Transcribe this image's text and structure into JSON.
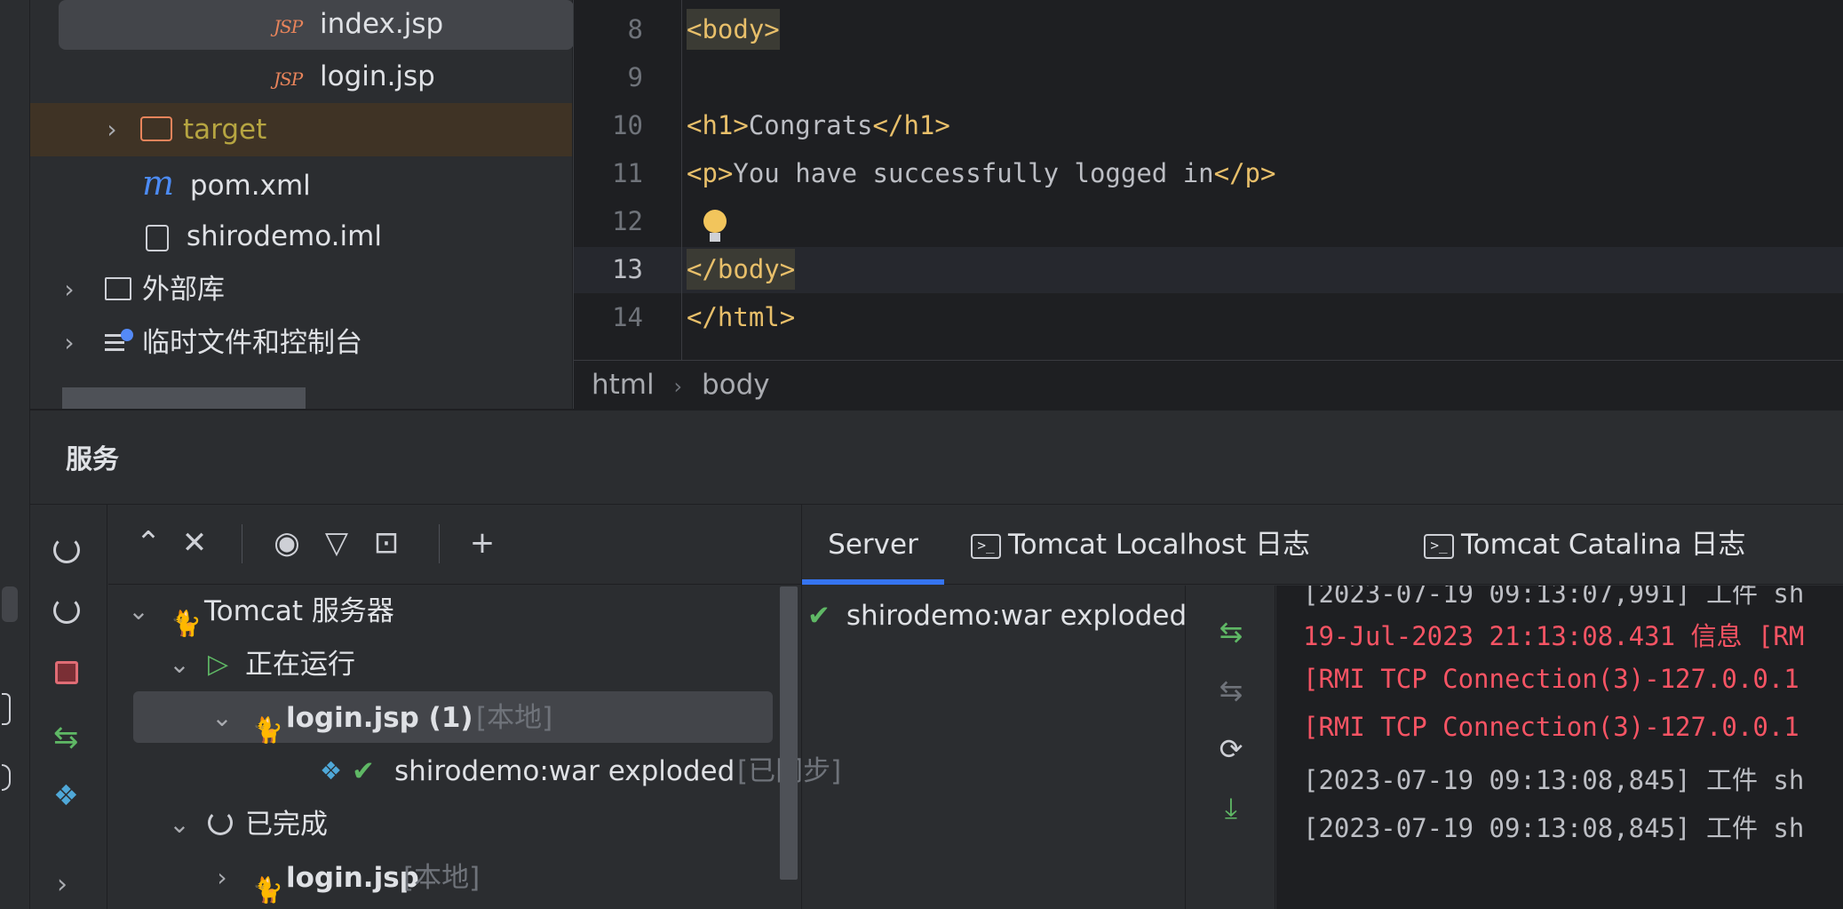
{
  "project": {
    "files": [
      {
        "icon": "jsp-file-icon",
        "badge": "JSP",
        "label": "index.jsp",
        "selected": true
      },
      {
        "icon": "jsp-file-icon",
        "badge": "JSP",
        "label": "login.jsp"
      },
      {
        "icon": "folder-icon",
        "label": "target",
        "excluded": true
      },
      {
        "icon": "maven-icon",
        "badge": "m",
        "label": "pom.xml"
      },
      {
        "icon": "module-file-icon",
        "label": "shirodemo.iml"
      },
      {
        "icon": "library-icon",
        "label": "外部库"
      },
      {
        "icon": "scratch-icon",
        "label": "临时文件和控制台"
      }
    ]
  },
  "editor": {
    "lines": [
      {
        "no": "8",
        "text": "<body>"
      },
      {
        "no": "9",
        "text": ""
      },
      {
        "no": "10",
        "text": "<h1>Congrats</h1>"
      },
      {
        "no": "11",
        "text": "<p>You have successfully logged in</p>"
      },
      {
        "no": "12",
        "text": ""
      },
      {
        "no": "13",
        "text": "</body>"
      },
      {
        "no": "14",
        "text": "</html>"
      }
    ],
    "code": {
      "l8": "<body>",
      "l10_open": "<h1>",
      "l10_text": "Congrats",
      "l10_close": "</h1>",
      "l11_open": "<p>",
      "l11_text": "You have successfully logged in",
      "l11_close": "</p>",
      "l13": "</body>",
      "l14": "</html>"
    },
    "current_line": "13",
    "breadcrumbs": [
      "html",
      "body"
    ],
    "breadcrumb_sep": "›"
  },
  "services": {
    "title": "服务",
    "tree": {
      "server": "Tomcat 服务器",
      "running": "正在运行",
      "running_item": {
        "name": "login.jsp (1)",
        "tag": "[本地]"
      },
      "artifact": {
        "name": "shirodemo:war exploded",
        "tag": "[已同步]"
      },
      "finished": "已完成",
      "finished_item": {
        "name": "login.jsp",
        "tag": "[本地]"
      }
    },
    "tabs": [
      "Server",
      "Tomcat Localhost 日志",
      "Tomcat Catalina 日志"
    ],
    "active_tab": "Server",
    "deployment": "shirodemo:war exploded",
    "log": [
      {
        "text": "[2023-07-19 09:13:07,991] 工件 sh",
        "level": "info"
      },
      {
        "text": "19-Jul-2023 21:13:08.431 信息 [RM",
        "level": "error"
      },
      {
        "text": "[RMI TCP Connection(3)-127.0.0.1",
        "level": "error"
      },
      {
        "text": "[RMI TCP Connection(3)-127.0.0.1",
        "level": "error"
      },
      {
        "text": "[2023-07-19 09:13:08,845] 工件 sh",
        "level": "info"
      },
      {
        "text": "[2023-07-19 09:13:08,845] 工件 sh",
        "level": "info"
      }
    ]
  },
  "colors": {
    "accent": "#3574f0",
    "error": "#f75464",
    "ok": "#5fb865",
    "tag": "#e8bf6a"
  }
}
